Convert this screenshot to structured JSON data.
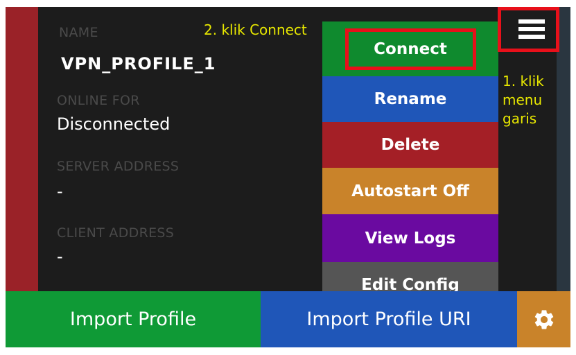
{
  "profile": {
    "name_label": "NAME",
    "name_value": "VPN_PROFILE_1",
    "online_label": "ONLINE FOR",
    "online_value": "Disconnected",
    "server_label": "SERVER ADDRESS",
    "server_value": "-",
    "client_label": "CLIENT ADDRESS",
    "client_value": "-"
  },
  "annotations": {
    "step2": "2. klik Connect",
    "step1_line1": "1. klik",
    "step1_line2": "menu",
    "step1_line3": "garis"
  },
  "menu": {
    "connect": "Connect",
    "rename": "Rename",
    "delete": "Delete",
    "autostart": "Autostart Off",
    "view_logs": "View Logs",
    "edit_config": "Edit Config"
  },
  "bottom": {
    "import_profile": "Import Profile",
    "import_profile_uri": "Import Profile URI"
  },
  "icons": {
    "menu": "hamburger-icon",
    "settings": "gear-icon"
  },
  "colors": {
    "green": "#0f9a36",
    "blue": "#1f56b8",
    "red": "#a41f26",
    "orange": "#c9832a",
    "purple": "#6a0aa0",
    "gray": "#555555",
    "highlight": "#e8101a",
    "annotation": "#e8e800"
  }
}
